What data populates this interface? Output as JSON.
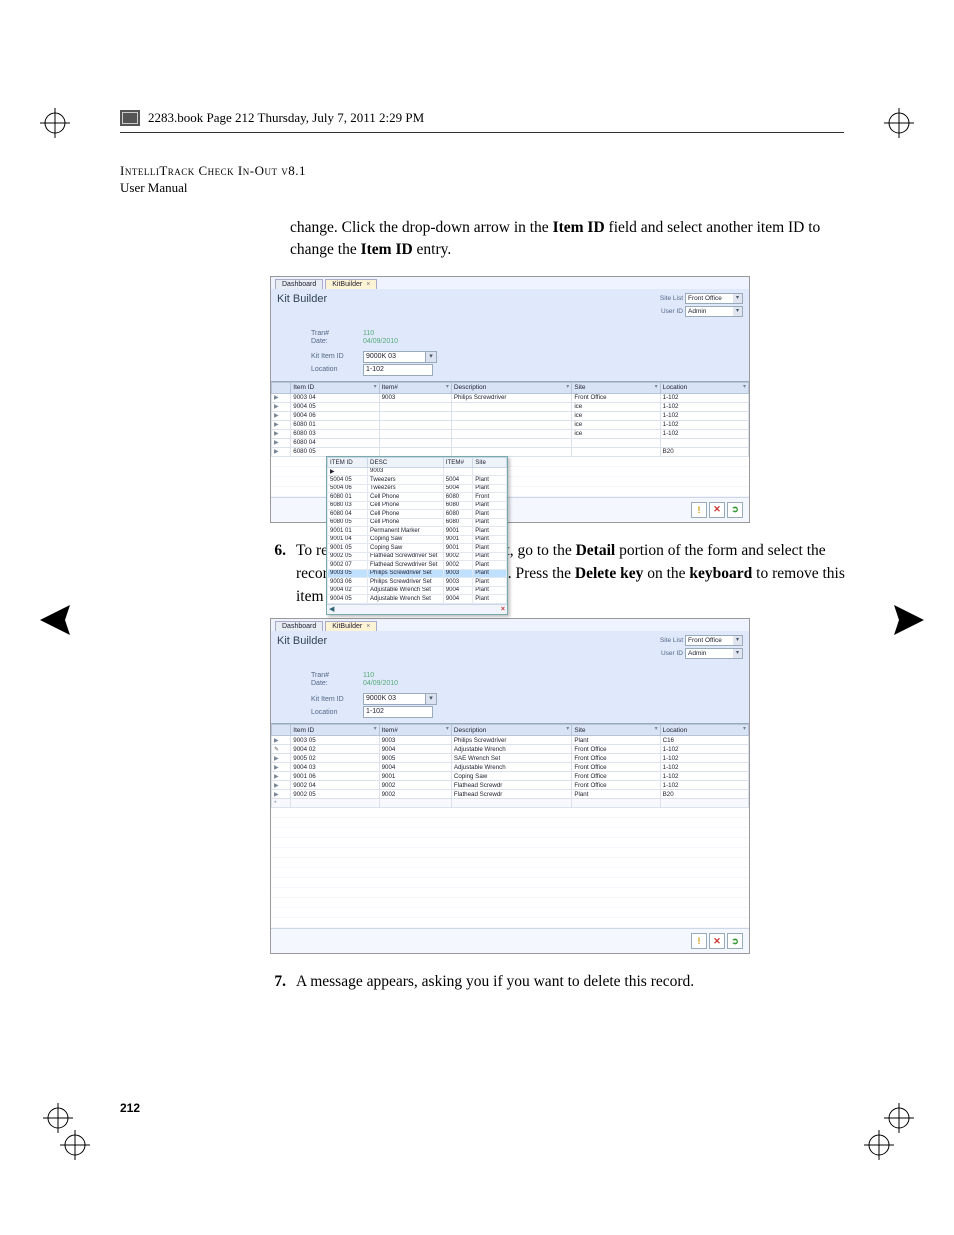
{
  "book_tag": "2283.book  Page 212  Thursday, July 7, 2011  2:29 PM",
  "header": {
    "title_line1": "IntelliTrack Check In-Out v8.1",
    "title_line2": "User Manual"
  },
  "intro_para": "change. Click the drop-down arrow in the Item ID field and select another item ID to change the Item ID entry.",
  "intro_bold": {
    "b1": "Item ID",
    "b2": "Item ID"
  },
  "step6": {
    "num": "6.",
    "text_a": "To remove an item ID from the kit, go to the ",
    "b_detail": "Detail",
    "text_b": " portion of the form and select the record line that you want to delete. Press the ",
    "b_delete": "Delete key",
    "text_c": " on the ",
    "b_keyboard": "keyboard",
    "text_d": " to remove this item ID from the kit."
  },
  "step7": {
    "num": "7.",
    "text": "A message appears, asking you if you want to delete this record."
  },
  "page_number": "212",
  "shot_common": {
    "tab_dashboard": "Dashboard",
    "tab_kitbuilder": "KitBuilder",
    "title": "Kit Builder",
    "site_list_lbl": "Site List",
    "site_list_val": "Front Office",
    "user_id_lbl": "User ID",
    "user_id_val": "Admin",
    "tran_lbl": "Tran#",
    "tran_val": "110",
    "date_lbl": "Date:",
    "date_val": "04/09/2010",
    "kititem_lbl": "Kit Item ID",
    "kititem_val": "9000K 03",
    "location_lbl": "Location",
    "location_val": "1-102",
    "grid_cols": [
      "Item ID",
      "Item#",
      "Description",
      "Site",
      "Location"
    ],
    "footer_warn_title": "warning",
    "footer_close_title": "close",
    "footer_save_title": "save"
  },
  "shot1": {
    "main_rows": [
      [
        "9003 04",
        "9003",
        "Philips Screwdriver",
        "Front Office",
        "1-102"
      ],
      [
        "9004 05",
        "",
        "",
        "ice",
        "1-102"
      ],
      [
        "9004 06",
        "",
        "",
        "ice",
        "1-102"
      ],
      [
        "6080 01",
        "",
        "",
        "ice",
        "1-102"
      ],
      [
        "6080 03",
        "",
        "",
        "ice",
        "1-102"
      ],
      [
        "6080 04",
        "",
        "",
        "",
        " "
      ],
      [
        "6080 05",
        "",
        "",
        "",
        "B20"
      ]
    ],
    "popup_header": [
      "ITEM ID",
      "DESC",
      "ITEM#",
      "Site"
    ],
    "popup_rows": [
      {
        "sel": true,
        "cells": [
          "▶",
          "9003",
          "",
          "",
          "",
          "",
          ""
        ]
      },
      {
        "cells": [
          "5004 05",
          "Tweezers",
          "5004",
          "Plant"
        ]
      },
      {
        "cells": [
          "5004 06",
          "Tweezers",
          "5004",
          "Plant"
        ]
      },
      {
        "cells": [
          "6080 01",
          "Cell Phone",
          "6080",
          "Front"
        ]
      },
      {
        "cells": [
          "6080 03",
          "Cell Phone",
          "6080",
          "Plant"
        ]
      },
      {
        "cells": [
          "6080 04",
          "Cell Phone",
          "6080",
          "Plant"
        ]
      },
      {
        "cells": [
          "6080 05",
          "Cell Phone",
          "6080",
          "Plant"
        ]
      },
      {
        "cells": [
          "9001 01",
          "Permanent Marker",
          "9001",
          "Plant"
        ]
      },
      {
        "cells": [
          "9001 04",
          "Coping Saw",
          "9001",
          "Plant"
        ]
      },
      {
        "cells": [
          "9001 05",
          "Coping Saw",
          "9001",
          "Plant"
        ]
      },
      {
        "cells": [
          "9002 05",
          "Flathead Screwdriver Set",
          "9002",
          "Plant"
        ]
      },
      {
        "cells": [
          "9002 07",
          "Flathead Screwdriver Set",
          "9002",
          "Plant"
        ]
      },
      {
        "cells": [
          "9003 05",
          "Philips Screwdriver Set",
          "9003",
          "Plant"
        ],
        "hl": true
      },
      {
        "cells": [
          "9003 06",
          "Philips Screwdriver Set",
          "9003",
          "Plant"
        ]
      },
      {
        "cells": [
          "9004 02",
          "Adjustable Wrench Set",
          "9004",
          "Plant"
        ]
      },
      {
        "cells": [
          "9004 05",
          "Adjustable Wrench Set",
          "9004",
          "Plant"
        ]
      }
    ]
  },
  "shot2": {
    "rows": [
      {
        "cells": [
          "9003 05",
          "9003",
          "Philips Screwdriver",
          "Plant",
          "C16"
        ]
      },
      {
        "cells": [
          "9004 02",
          "9004",
          "Adjustable Wrench",
          "Front Office",
          "1-102"
        ],
        "pencil": true
      },
      {
        "cells": [
          "9005 02",
          "9005",
          "SAE Wrench Set",
          "Front Office",
          "1-102"
        ]
      },
      {
        "cells": [
          "9004 03",
          "9004",
          "Adjustable Wrench",
          "Front Office",
          "1-102"
        ]
      },
      {
        "cells": [
          "9001 06",
          "9001",
          "Coping Saw",
          "Front Office",
          "1-102"
        ]
      },
      {
        "cells": [
          "9002 04",
          "9002",
          "Flathead Screwdr",
          "Front Office",
          "1-102"
        ]
      },
      {
        "cells": [
          "9002 05",
          "9002",
          "Flathead Screwdr",
          "Plant",
          "B20"
        ]
      }
    ],
    "new_row_marker": "*"
  }
}
